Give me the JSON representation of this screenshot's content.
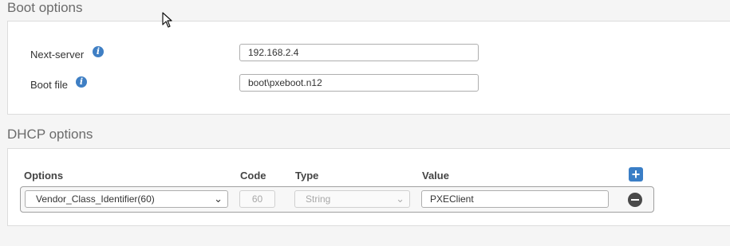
{
  "boot_options": {
    "title": "Boot options",
    "next_server": {
      "label": "Next-server",
      "value": "192.168.2.4"
    },
    "boot_file": {
      "label": "Boot file",
      "value": "boot\\pxeboot.n12"
    }
  },
  "dhcp_options": {
    "title": "DHCP options",
    "columns": {
      "options": "Options",
      "code": "Code",
      "type": "Type",
      "value": "Value"
    },
    "rows": [
      {
        "option": "Vendor_Class_Identifier(60)",
        "code": "60",
        "type": "String",
        "value": "PXEClient"
      }
    ]
  },
  "icons": {
    "info": "info-icon",
    "add": "plus-icon",
    "remove": "minus-circle-icon",
    "cursor": "mouse-pointer-icon",
    "dropdown": "chevron-down-icon"
  },
  "colors": {
    "accent": "#3a7ec6",
    "info": "#3f7fc4",
    "remove": "#4a4a4a"
  }
}
